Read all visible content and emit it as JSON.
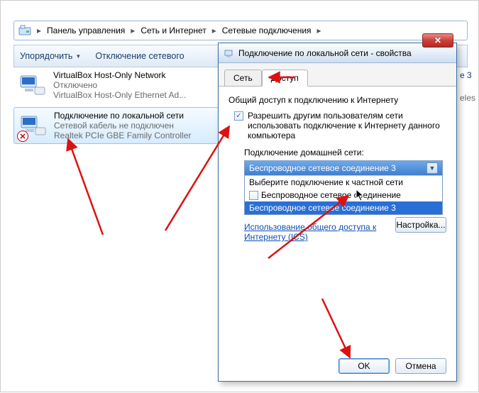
{
  "addressbar": {
    "items": [
      "Панель управления",
      "Сеть и Интернет",
      "Сетевые подключения"
    ]
  },
  "toolbar": {
    "organize": "Упорядочить",
    "disable": "Отключение сетевого"
  },
  "netlist": {
    "items": [
      {
        "title": "VirtualBox Host-Only Network",
        "status": "Отключено",
        "device": "VirtualBox Host-Only Ethernet Ad..."
      },
      {
        "title": "Подключение по локальной сети",
        "status": "Сетевой кабель не подключен",
        "device": "Realtek PCIe GBE Family Controller"
      }
    ]
  },
  "peek": {
    "line1": "е 3",
    "line2": "eles"
  },
  "dialog": {
    "title": "Подключение по локальной сети - свойства",
    "tabs": {
      "net": "Сеть",
      "access": "Доступ"
    },
    "group_title": "Общий доступ к подключению к Интернету",
    "check1": "Разрешить другим пользователям сети использовать подключение к Интернету данного компьютера",
    "combo_label": "Подключение домашней сети:",
    "combo_selected": "Беспроводное сетевое соединение 3",
    "combo_options": [
      "Выберите подключение к частной сети",
      "Беспроводное сетевое соединение",
      "Беспроводное сетевое соединение 3"
    ],
    "check2_label": "",
    "link": "Использование общего доступа к Интернету (ICS)",
    "settings_btn": "Настройка...",
    "ok": "OK",
    "cancel": "Отмена"
  }
}
